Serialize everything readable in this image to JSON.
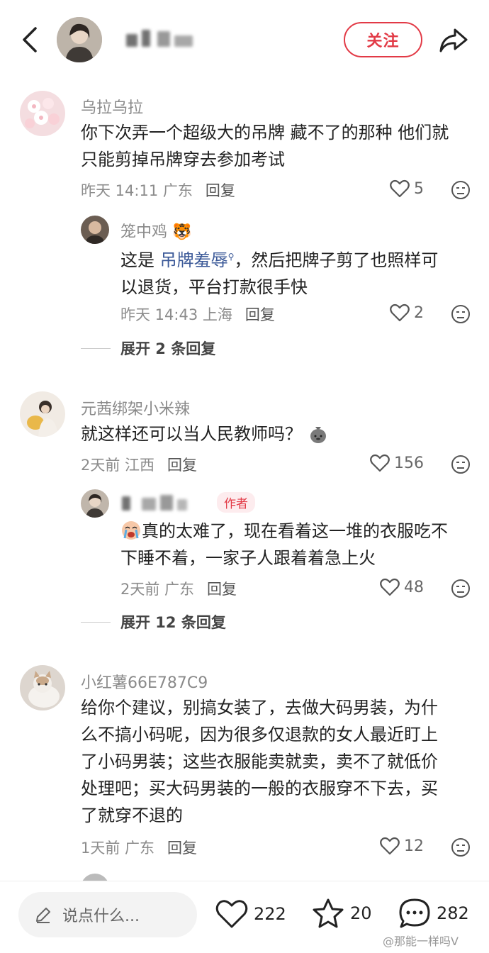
{
  "header": {
    "follow_label": "关注"
  },
  "comments": [
    {
      "name": "乌拉乌拉",
      "text_lines": [
        "你下次弄一个超级大的吊牌 藏不了的那种 他们就",
        "只能剪掉吊牌穿去参加考试"
      ],
      "time": "昨天 14:11 广东",
      "reply_label": "回复",
      "likes": "5"
    },
    {
      "name": "笼中鸡",
      "name_emoji": "🐯",
      "prefix": "这是 ",
      "tag": "吊牌羞辱",
      "text_after_tag": "，然后把牌子剪了也照样可",
      "text_line2": "以退货，平台打款很手快",
      "time": "昨天 14:43 上海",
      "reply_label": "回复",
      "likes": "2"
    },
    {
      "expand": "展开 2 条回复"
    },
    {
      "name": "元茜绑架小米辣",
      "text": "就这样还可以当人民教师吗？",
      "time": "2天前 江西",
      "reply_label": "回复",
      "likes": "156"
    },
    {
      "author_badge": "作者",
      "text_lines": [
        "真的太难了，现在看着这一堆的衣服吃不",
        "下睡不着，一家子人跟着着急上火"
      ],
      "time": "2天前 广东",
      "reply_label": "回复",
      "likes": "48"
    },
    {
      "expand": "展开 12 条回复"
    },
    {
      "name": "小红薯66E787C9",
      "text_lines": [
        "给你个建议，别搞女装了，去做大码男装，为什",
        "么不搞小码呢，因为很多仅退款的女人最近盯上",
        "了小码男装；这些衣服能卖就卖，卖不了就低价",
        "处理吧；买大码男装的一般的衣服穿不下去，买",
        "了就穿不退的"
      ],
      "time": "1天前 广东",
      "reply_label": "回复",
      "likes": "12"
    }
  ],
  "bottom": {
    "input_placeholder": "说点什么...",
    "likes": "222",
    "stars": "20",
    "comments": "282"
  },
  "watermark": "@那能一样吗V",
  "colors": {
    "accent": "#e23a46",
    "tag": "#3b5998",
    "meta": "#8c8c8c"
  }
}
